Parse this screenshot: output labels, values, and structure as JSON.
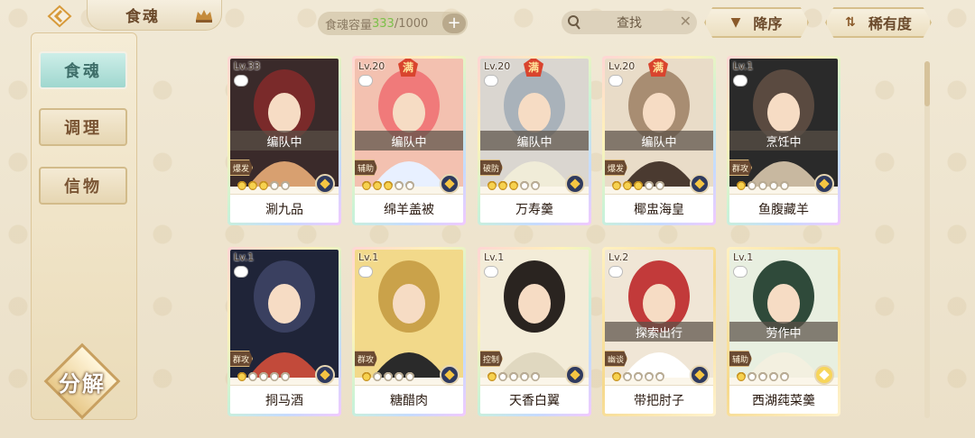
{
  "header": {
    "title": "食魂",
    "capacity_label": "食魂容量",
    "capacity_current": "333",
    "capacity_max": "/1000",
    "capacity_add": "+",
    "search_placeholder": "查找",
    "sort_order": "降序",
    "sort_by": "稀有度"
  },
  "sidebar": {
    "items": [
      {
        "label": "食魂",
        "active": true
      },
      {
        "label": "调理",
        "active": false
      },
      {
        "label": "信物",
        "active": false
      }
    ],
    "decompose_label": "分解"
  },
  "cards": [
    {
      "level": "Lv.33",
      "full": "",
      "status": "编队中",
      "role": "爆发",
      "stars": 3,
      "element": "dark",
      "name": "涮九品"
    },
    {
      "level": "Lv.20",
      "full": "满",
      "status": "编队中",
      "role": "辅助",
      "stars": 3,
      "element": "dark",
      "name": "绵羊盖被"
    },
    {
      "level": "Lv.20",
      "full": "满",
      "status": "编队中",
      "role": "破防",
      "stars": 3,
      "element": "dark",
      "name": "万寿羹"
    },
    {
      "level": "Lv.20",
      "full": "满",
      "status": "编队中",
      "role": "爆发",
      "stars": 3,
      "element": "dark",
      "name": "椰盅海皇"
    },
    {
      "level": "Lv.1",
      "full": "",
      "status": "烹饪中",
      "role": "群攻",
      "stars": 1,
      "element": "dark",
      "name": "鱼腹藏羊"
    },
    {
      "level": "Lv.1",
      "full": "",
      "status": "",
      "role": "群攻",
      "stars": 1,
      "element": "dark",
      "name": "挏马酒"
    },
    {
      "level": "Lv.1",
      "full": "",
      "status": "",
      "role": "群攻",
      "stars": 1,
      "element": "dark",
      "name": "糖醋肉"
    },
    {
      "level": "Lv.1",
      "full": "",
      "status": "",
      "role": "控制",
      "stars": 1,
      "element": "dark",
      "name": "天香白翼"
    },
    {
      "level": "Lv.2",
      "full": "",
      "status": "探索出行",
      "role": "幽谈",
      "stars": 1,
      "element": "dark",
      "name": "带把肘子"
    },
    {
      "level": "Lv.1",
      "full": "",
      "status": "劳作中",
      "role": "辅助",
      "stars": 1,
      "element": "yellow",
      "name": "西湖莼菜羹"
    }
  ],
  "colors": {
    "accent": "#9fd7cf",
    "capacity_current": "#7cc04a",
    "background": "#efe6d2"
  }
}
